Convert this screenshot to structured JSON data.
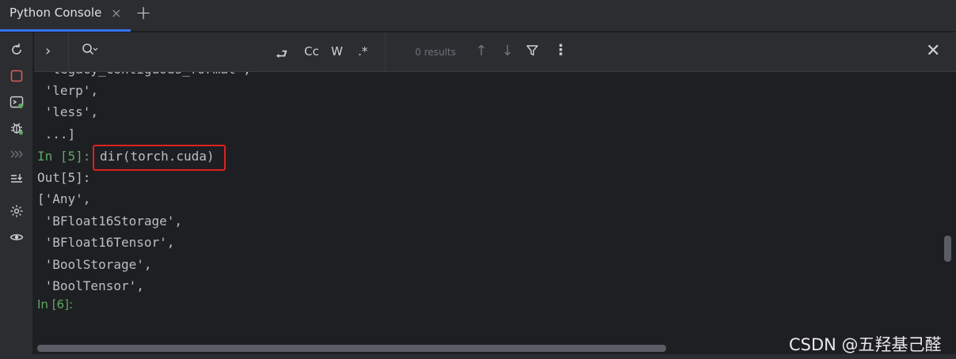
{
  "tab": {
    "label": "Python Console",
    "close": "×",
    "add": "+"
  },
  "findbar": {
    "expand": "›",
    "opt_wrap": "⮐",
    "opt_case": "Cc",
    "opt_word": "W",
    "opt_regex": ".*",
    "results": "0 results",
    "prev": "↑",
    "next": "↓",
    "more": "⋮",
    "close": "✕"
  },
  "console": {
    "lines": [
      " 'legacy_contiguous_format',",
      " 'lerp',",
      " 'less',",
      " ...]",
      "dir(torch.cuda)",
      "Out[5]:",
      "['Any',",
      " 'BFloat16Storage',",
      " 'BFloat16Tensor',",
      " 'BoolStorage',",
      " 'BoolTensor',"
    ],
    "prompt_in5": "In [5]:",
    "prompt_in6": "In [6]:"
  },
  "watermark": "CSDN @五羟基己醛",
  "colors": {
    "accent": "#3574f0",
    "prompt": "#5fa864",
    "highlight_box": "#e0201f"
  }
}
